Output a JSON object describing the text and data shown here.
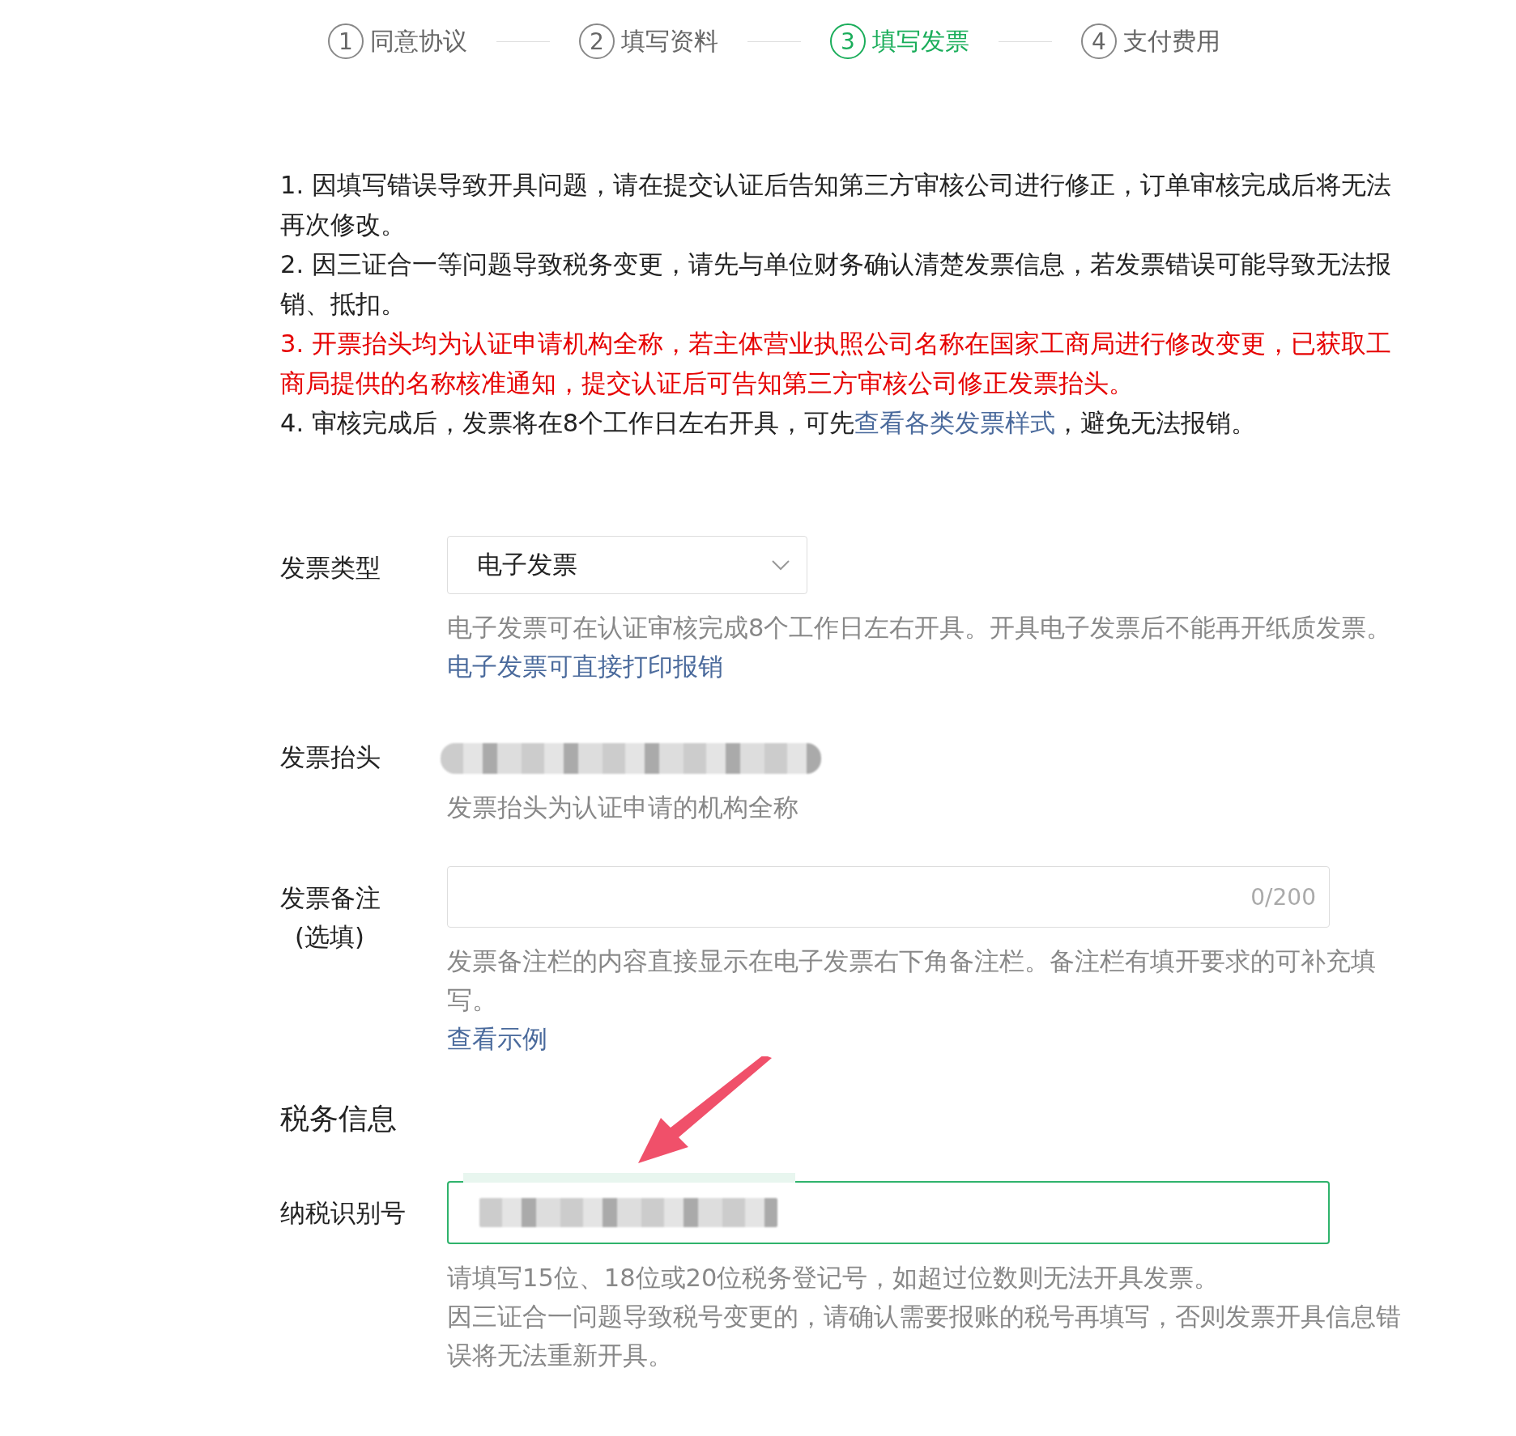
{
  "steps": [
    {
      "number": "1",
      "label": "同意协议",
      "selected": false
    },
    {
      "number": "2",
      "label": "填写资料",
      "selected": false
    },
    {
      "number": "3",
      "label": "填写发票",
      "selected": true
    },
    {
      "number": "4",
      "label": "支付费用",
      "selected": false
    }
  ],
  "notices": [
    {
      "text": "1. 因填写错误导致开具问题，请在提交认证后告知第三方审核公司进行修正，订单审核完成后将无法再次修改。",
      "warning": false
    },
    {
      "text": "2. 因三证合一等问题导致税务变更，请先与单位财务确认清楚发票信息，若发票错误可能导致无法报销、抵扣。",
      "warning": false
    },
    {
      "text": "3. 开票抬头均为认证申请机构全称，若主体营业执照公司名称在国家工商局进行修改变更，已获取工商局提供的名称核准通知，提交认证后可告知第三方审核公司修正发票抬头。",
      "warning": true
    },
    {
      "text": "4. 审核完成后，发票将在8个工作日左右开具，可先",
      "link": "查看各类发票样式",
      "text_after": "，避免无法报销。",
      "warning": false
    }
  ],
  "invoice_fields": [
    {
      "kind": "select",
      "label": "发票类型",
      "value": "电子发票",
      "hints": [
        "电子发票可在认证审核完成8个工作日左右开具。开具电子发票后不能再开纸质发票。"
      ],
      "hint_link": "电子发票可直接打印报销"
    },
    {
      "kind": "static",
      "label": "发票抬头",
      "hints": [
        "发票抬头为认证申请的机构全称"
      ]
    },
    {
      "kind": "textarea",
      "label": "发票备注",
      "sublabel": "(选填)",
      "counter": "0/200",
      "hints": [
        "发票备注栏的内容直接显示在电子发票右下角备注栏。备注栏有填开要求的可补充填写。"
      ],
      "hint_link": "查看示例"
    }
  ],
  "tax_section": {
    "title": "税务信息",
    "fields": [
      {
        "kind": "input",
        "label": "纳税识别号",
        "focused": true,
        "hints": [
          "请填写15位、18位或20位税务登记号，如超过位数则无法开具发票。",
          "因三证合一问题导致税号变更的，请确认需要报账的税号再填写，否则发票开具信息错误将无法重新开具。"
        ]
      }
    ]
  }
}
